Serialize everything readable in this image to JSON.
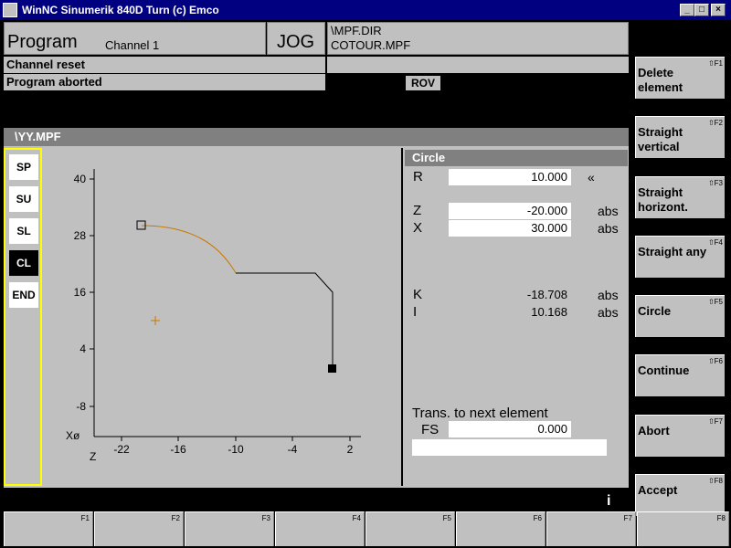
{
  "window": {
    "title": "WinNC Sinumerik 840D Turn (c) Emco",
    "minimize": "_",
    "maximize": "□",
    "close": "×"
  },
  "header": {
    "mode": "Program",
    "channel": "Channel 1",
    "op_mode": "JOG",
    "dir": "\\MPF.DIR",
    "file": "COTOUR.MPF",
    "status1": "Channel reset",
    "status2": "Program aborted",
    "rov": "ROV"
  },
  "file_bar": "\\YY.MPF",
  "side_buttons": [
    {
      "label": "SP",
      "active": false
    },
    {
      "label": "SU",
      "active": false
    },
    {
      "label": "SL",
      "active": false
    },
    {
      "label": "CL",
      "active": true
    },
    {
      "label": "END",
      "active": false
    }
  ],
  "plot": {
    "y_ticks": [
      "40",
      "28",
      "16",
      "4",
      "-8"
    ],
    "x_ticks": [
      "-22",
      "-16",
      "-10",
      "-4",
      "2"
    ],
    "x_axis_label": "Z",
    "y_axis_label": "Xø",
    "contour_color": "#000000",
    "arc_color": "#c87800",
    "center_color": "#c87800"
  },
  "circle": {
    "header": "Circle",
    "R_label": "R",
    "R_value": "10.000",
    "R_suffix": "«",
    "Z_label": "Z",
    "Z_value": "-20.000",
    "Z_unit": "abs",
    "X_label": "X",
    "X_value": "30.000",
    "X_unit": "abs",
    "K_label": "K",
    "K_value": "-18.708",
    "K_unit": "abs",
    "I_label": "I",
    "I_value": "10.168",
    "I_unit": "abs",
    "trans_label": "Trans. to next element",
    "FS_label": "FS",
    "FS_value": "0.000"
  },
  "softkeys": [
    {
      "label": "Delete element",
      "key": "⇧F1"
    },
    {
      "label": "Straight vertical",
      "key": "⇧F2"
    },
    {
      "label": "Straight horizont.",
      "key": "⇧F3"
    },
    {
      "label": "Straight any",
      "key": "⇧F4"
    },
    {
      "label": "Circle",
      "key": "⇧F5"
    },
    {
      "label": "Continue",
      "key": "⇧F6"
    },
    {
      "label": "Abort",
      "key": "⇧F7"
    },
    {
      "label": "Accept",
      "key": "⇧F8"
    }
  ],
  "fkeys": [
    "F1",
    "F2",
    "F3",
    "F4",
    "F5",
    "F6",
    "F7",
    "F8"
  ],
  "info_icon": "i"
}
